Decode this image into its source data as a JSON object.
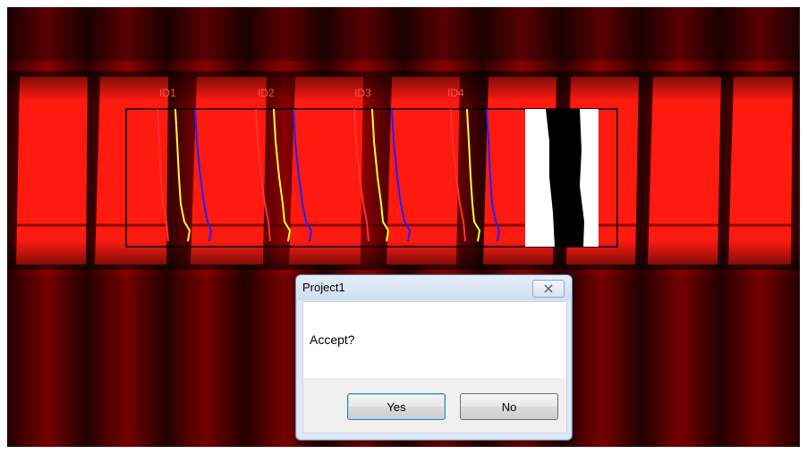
{
  "image_view": {
    "icon": "microscopy-image",
    "accent_colors": {
      "red_trace": "#ff2a2a",
      "yellow_trace": "#ffff30",
      "blue_trace": "#2020ff",
      "roi_border": "#000000"
    },
    "markers": [
      "ID1",
      "ID2",
      "ID3",
      "ID4"
    ]
  },
  "dialog": {
    "title": "Project1",
    "message": "Accept?",
    "close_icon": "close-icon",
    "buttons": {
      "yes": "Yes",
      "no": "No"
    }
  }
}
